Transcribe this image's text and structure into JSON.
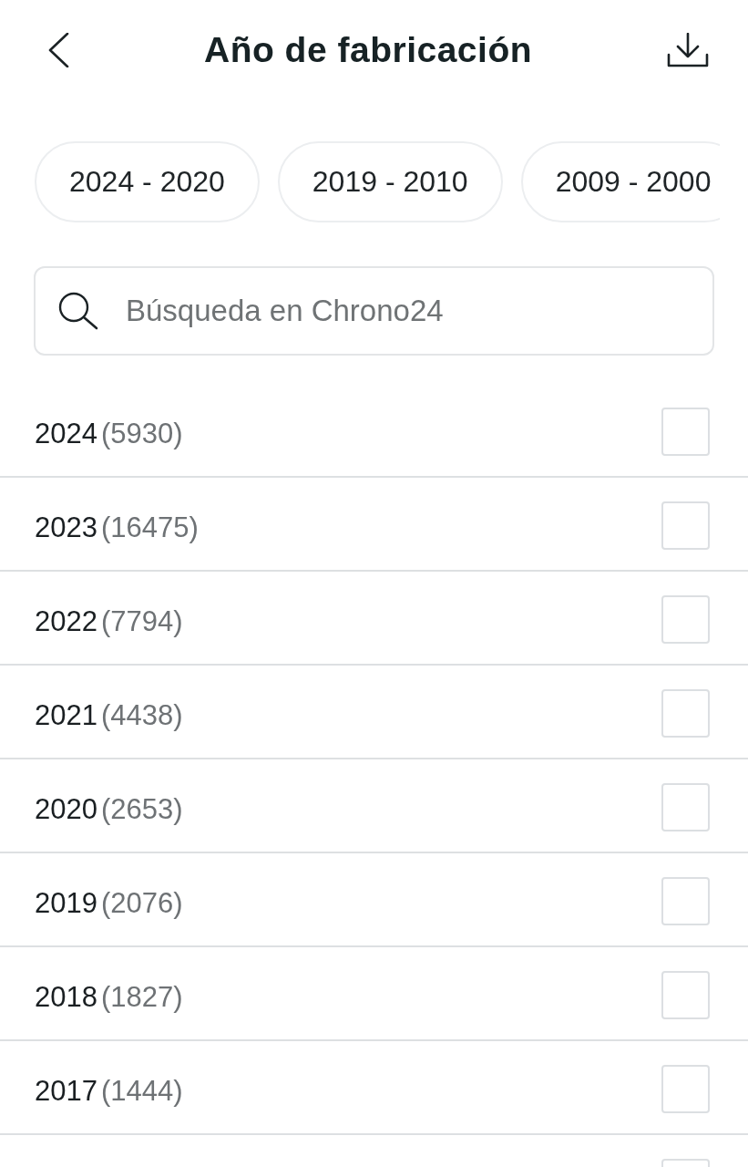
{
  "header": {
    "title": "Año de fabricación"
  },
  "chips": [
    {
      "label": "2024 - 2020",
      "selected": false
    },
    {
      "label": "2019 - 2010",
      "selected": false
    },
    {
      "label": "2009 - 2000",
      "selected": false
    }
  ],
  "search": {
    "placeholder": "Búsqueda en Chrono24"
  },
  "rows": [
    {
      "year": "2024",
      "count": "(5930)",
      "checked": false
    },
    {
      "year": "2023",
      "count": "(16475)",
      "checked": false
    },
    {
      "year": "2022",
      "count": "(7794)",
      "checked": false
    },
    {
      "year": "2021",
      "count": "(4438)",
      "checked": false
    },
    {
      "year": "2020",
      "count": "(2653)",
      "checked": false
    },
    {
      "year": "2019",
      "count": "(2076)",
      "checked": false
    },
    {
      "year": "2018",
      "count": "(1827)",
      "checked": false
    },
    {
      "year": "2017",
      "count": "(1444)",
      "checked": false
    },
    {
      "checked": false
    }
  ]
}
